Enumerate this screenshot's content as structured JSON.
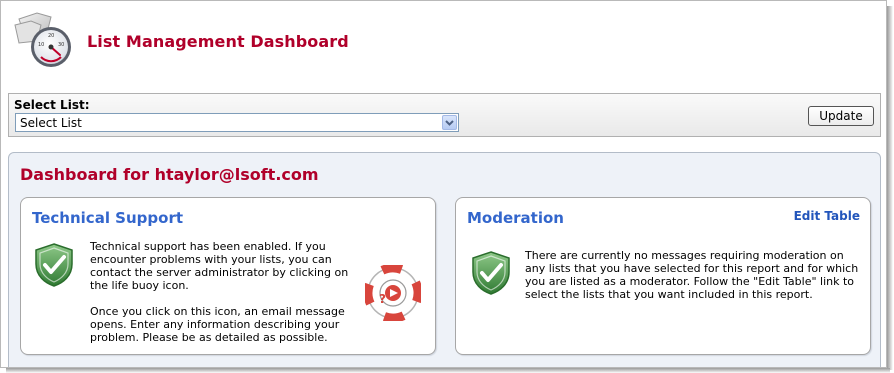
{
  "header": {
    "title": "List Management Dashboard",
    "logo_icon": "gauge-icon"
  },
  "select": {
    "label": "Select List:",
    "selected_value": "Select List",
    "update_label": "Update"
  },
  "dashboard": {
    "title": "Dashboard for htaylor@lsoft.com",
    "technical_support": {
      "title": "Technical Support",
      "paragraphs": [
        "Technical support has been enabled. If you encounter problems with your lists, you can contact the server administrator by clicking on the life buoy icon.",
        "Once you click on this icon, an email message opens. Enter any information describing your problem. Please be as detailed as possible."
      ],
      "status_icon": "green-shield-check-icon",
      "action_icon": "life-buoy-icon"
    },
    "moderation": {
      "title": "Moderation",
      "edit_link": "Edit Table",
      "text": "There are currently no messages requiring moderation on any lists that you have selected for this report and for which you are listed as a moderator. Follow the \"Edit Table\" link to select the lists that you want included in this report.",
      "status_icon": "green-shield-check-icon"
    }
  },
  "colors": {
    "title_red": "#b0002a",
    "panel_blue": "#3366cc",
    "dashboard_bg": "#eef2f8"
  }
}
